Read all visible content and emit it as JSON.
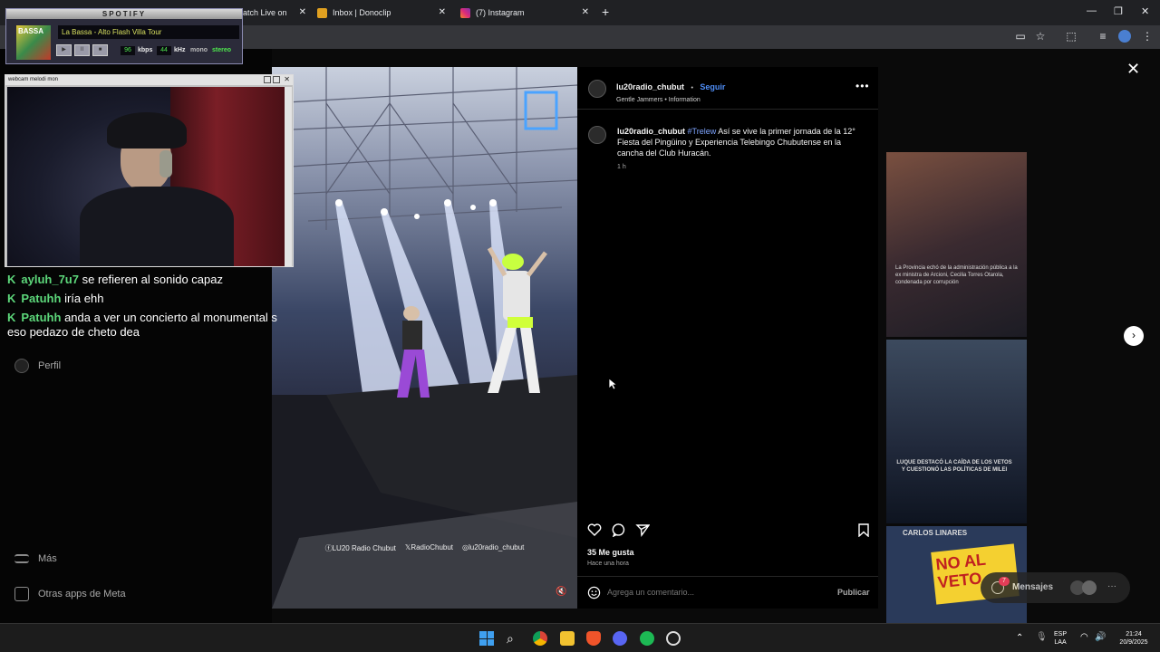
{
  "browser": {
    "tabs": [
      {
        "title": "atch Live on "
      },
      {
        "title": "Inbox | Donoclip"
      },
      {
        "title": "(7) Instagram"
      }
    ],
    "colors": {
      "tabbar": "#202124",
      "toolbar": "#35363a"
    }
  },
  "spotify": {
    "header": "SPOTIFY",
    "album_text": "BASSA",
    "track": "La Bassa - Alto Flash Villa Tour",
    "kbps_value": "96",
    "kbps_label": "kbps",
    "khz_value": "44",
    "khz_label": "kHz",
    "mono": "mono",
    "stereo": "stereo",
    "controls": [
      "▶",
      "II",
      "■"
    ]
  },
  "webcam": {
    "title": "webcam melodi mon"
  },
  "chat": {
    "messages": [
      {
        "user": "ayluh_7u7",
        "text": "se refieren al sonido capaz"
      },
      {
        "user": "Patuhh",
        "text": "iría ehh"
      },
      {
        "user": "Patuhh",
        "text": "anda a ver un concierto al monumental s"
      },
      {
        "user": "",
        "text": "eso pedazo de cheto dea"
      }
    ]
  },
  "instagram_nav": {
    "perfil": "Perfil",
    "mas": "Más",
    "otras": "Otras apps de Meta"
  },
  "post": {
    "username": "lu20radio_chubut",
    "follow": "Seguir",
    "audio": "Gentle Jammers",
    "audio_separator": "•",
    "info": "Information",
    "hashtag": "#Trelew",
    "caption": "Así se vive la primer jornada de la 12° Fiesta del Pingüino y Experiencia Telebingo Chubutense en la cancha del Club Huracán.",
    "time": "1 h",
    "likes": "35 Me gusta",
    "ago": "Hace una hora",
    "comment_placeholder": "Agrega un comentario...",
    "publish": "Publicar",
    "watermark": {
      "fb": "LU20 Radio Chubut",
      "x": "RadioChubut",
      "ig": "lu20radio_chubut"
    },
    "photo_logo": "LU20 RADIO CHUBUT"
  },
  "grid": {
    "thumb1_caption": "La Provincia echó de la administración pública a la ex ministra de Arcioni, Cecilia Torres Otarola, condenada por corrupción",
    "thumb2_caption": "LUQUE DESTACÓ LA CAÍDA DE LOS VETOS Y CUESTIONÓ LAS POLÍTICAS DE MILEI",
    "thumb3_title": "CARLOS LINARES",
    "thumb3_sign": "NO AL VETO"
  },
  "messages_widget": {
    "label": "Mensajes",
    "count": "7"
  },
  "taskbar": {
    "lang": "ESP",
    "region": "LAA",
    "time": "21:24",
    "date": "20/9/2025"
  }
}
